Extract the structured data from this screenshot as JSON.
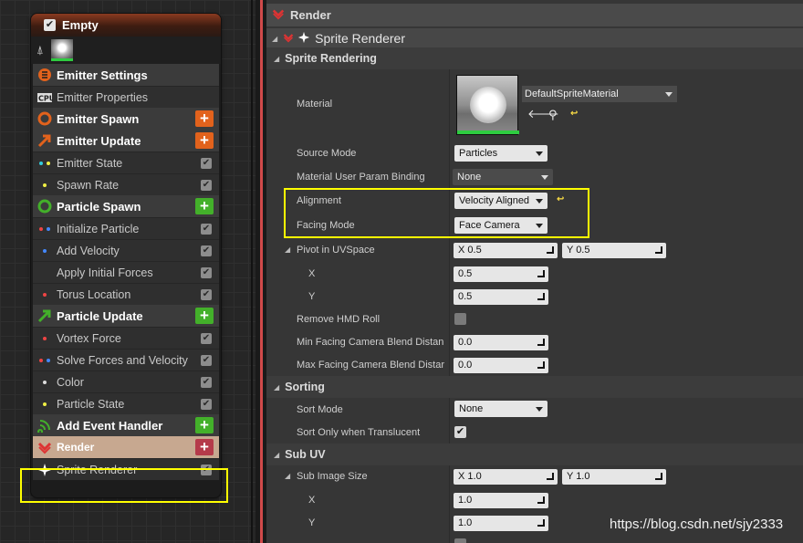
{
  "emitter": {
    "title": "Empty",
    "rows": [
      {
        "kind": "section",
        "label": "Emitter Settings",
        "icon": "gear-icon"
      },
      {
        "kind": "module",
        "label": "Emitter Properties",
        "icon": "cpu-icon"
      },
      {
        "kind": "section",
        "label": "Emitter Spawn",
        "icon": "spawn-circle-icon",
        "plus": "orange"
      },
      {
        "kind": "section",
        "label": "Emitter Update",
        "icon": "update-arrow-icon",
        "plus": "orange"
      },
      {
        "kind": "module",
        "label": "Emitter State"
      },
      {
        "kind": "module",
        "label": "Spawn Rate"
      },
      {
        "kind": "section",
        "label": "Particle Spawn",
        "icon": "spawn-circle-icon",
        "plus": "green"
      },
      {
        "kind": "module",
        "label": "Initialize Particle"
      },
      {
        "kind": "module",
        "label": "Add Velocity"
      },
      {
        "kind": "module",
        "label": "Apply Initial Forces"
      },
      {
        "kind": "module",
        "label": "Torus Location"
      },
      {
        "kind": "section",
        "label": "Particle Update",
        "icon": "update-arrow-icon",
        "plus": "green"
      },
      {
        "kind": "module",
        "label": "Vortex Force"
      },
      {
        "kind": "module",
        "label": "Solve Forces and Velocity"
      },
      {
        "kind": "module",
        "label": "Color"
      },
      {
        "kind": "module",
        "label": "Particle State"
      },
      {
        "kind": "section",
        "label": "Add Event Handler",
        "icon": "event-icon",
        "plus": "green"
      },
      {
        "kind": "render",
        "label": "Render",
        "icon": "render-icon",
        "plus": "red"
      },
      {
        "kind": "module",
        "label": "Sprite Renderer",
        "icon": "sprite-icon"
      }
    ]
  },
  "details": {
    "category_render": "Render",
    "sprite_renderer": "Sprite Renderer",
    "sprite_rendering": "Sprite Rendering",
    "material_label": "Material",
    "material_value": "DefaultSpriteMaterial",
    "source_mode_label": "Source Mode",
    "source_mode_value": "Particles",
    "mat_user_param_label": "Material User Param Binding",
    "mat_user_param_value": "None",
    "alignment_label": "Alignment",
    "alignment_value": "Velocity Aligned",
    "facing_mode_label": "Facing Mode",
    "facing_mode_value": "Face Camera",
    "pivot_label": "Pivot in UVSpace",
    "pivot_x_combined": "X  0.5",
    "pivot_y_combined": "Y  0.5",
    "x_label": "X",
    "pivot_x": "0.5",
    "y_label": "Y",
    "pivot_y": "0.5",
    "remove_hmd_roll_label": "Remove HMD Roll",
    "min_facing_label": "Min Facing Camera Blend Distan",
    "min_facing_value": "0.0",
    "max_facing_label": "Max Facing Camera Blend Distar",
    "max_facing_value": "0.0",
    "sorting": "Sorting",
    "sort_mode_label": "Sort Mode",
    "sort_mode_value": "None",
    "sort_only_label": "Sort Only when Translucent",
    "sub_uv": "Sub UV",
    "sub_image_size_label": "Sub Image Size",
    "sub_x_combined": "X  1.0",
    "sub_y_combined": "Y  1.0",
    "sub_x": "1.0",
    "sub_y": "1.0"
  },
  "watermark": "https://blog.csdn.net/sjy2333"
}
